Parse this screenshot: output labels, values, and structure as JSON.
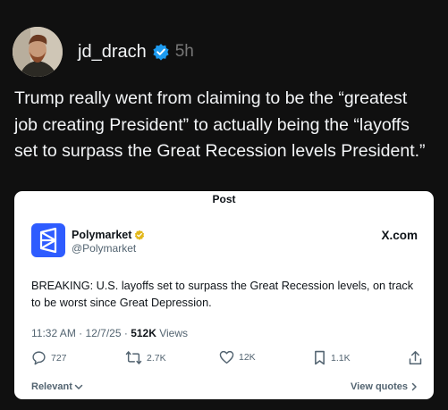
{
  "post": {
    "username": "jd_drach",
    "time": "5h",
    "text": "Trump really went from claiming to be the “greatest job creating President” to actually being the “layoffs set to surpass the Great Recession levels President.”"
  },
  "embed": {
    "title": "Post",
    "author_name": "Polymarket",
    "author_handle": "@Polymarket",
    "source": "X.com",
    "text": "BREAKING: U.S. layoffs set to surpass the Great Recession levels, on track to be worst since Great Depression.",
    "timestamp": "11:32 AM · 12/7/25 · ",
    "views_count": "512K",
    "views_label": " Views",
    "replies": "727",
    "reposts": "2.7K",
    "likes": "12K",
    "bookmarks": "1.1K",
    "relevant_label": "Relevant",
    "view_quotes_label": "View quotes"
  },
  "colors": {
    "background": "#101010",
    "verified": "#1d9bf0",
    "gold_badge": "#e2b719",
    "polymarket_blue": "#2e5cff"
  }
}
